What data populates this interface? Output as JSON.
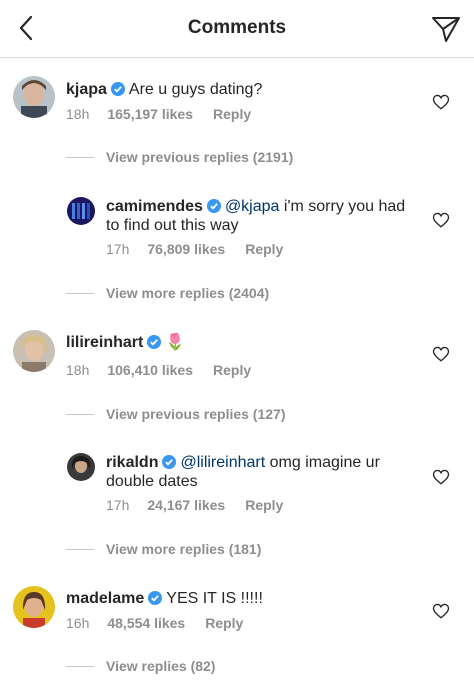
{
  "header": {
    "title": "Comments"
  },
  "colors": {
    "verified": "#3897f0",
    "mention": "#003569",
    "meta": "#8e8e8e"
  },
  "comments": [
    {
      "username": "kjapa",
      "text": "Are u guys dating?",
      "time": "18h",
      "likes": "165,197 likes",
      "reply": "Reply"
    },
    {
      "username": "camimendes",
      "mention": "@kjapa",
      "text_line1": " i'm sorry you had",
      "text_line2": "to find out this way",
      "time": "17h",
      "likes": "76,809 likes",
      "reply": "Reply"
    },
    {
      "username": "lilireinhart",
      "emoji": "🌷",
      "time": "18h",
      "likes": "106,410 likes",
      "reply": "Reply"
    },
    {
      "username": "rikaldn",
      "mention": "@lilireinhart",
      "text_line1": " omg imagine ur",
      "text_line2": "double dates",
      "time": "17h",
      "likes": "24,167 likes",
      "reply": "Reply"
    },
    {
      "username": "madelame",
      "text": "YES IT IS !!!!!",
      "time": "16h",
      "likes": "48,554 likes",
      "reply": "Reply"
    }
  ],
  "view_links": [
    "View previous replies (2191)",
    "View more replies (2404)",
    "View previous replies (127)",
    "View more replies (181)",
    "View replies (82)"
  ]
}
